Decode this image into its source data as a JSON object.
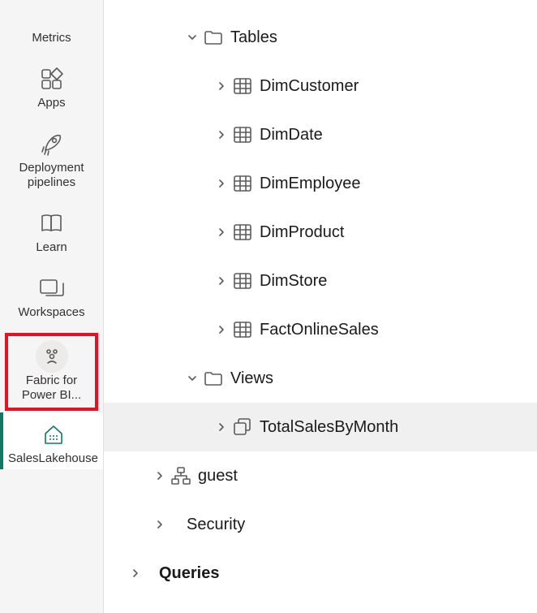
{
  "sidebar": {
    "items": [
      {
        "label": "Metrics"
      },
      {
        "label": "Apps"
      },
      {
        "label": "Deployment pipelines"
      },
      {
        "label": "Learn"
      },
      {
        "label": "Workspaces"
      },
      {
        "label": "Fabric for Power BI..."
      },
      {
        "label": "SalesLakehouse"
      }
    ]
  },
  "tree": {
    "tables": {
      "label": "Tables",
      "items": [
        "DimCustomer",
        "DimDate",
        "DimEmployee",
        "DimProduct",
        "DimStore",
        "FactOnlineSales"
      ]
    },
    "views": {
      "label": "Views",
      "items": [
        "TotalSalesByMonth"
      ]
    },
    "guest": {
      "label": "guest"
    },
    "security": {
      "label": "Security"
    },
    "queries": {
      "label": "Queries"
    }
  }
}
